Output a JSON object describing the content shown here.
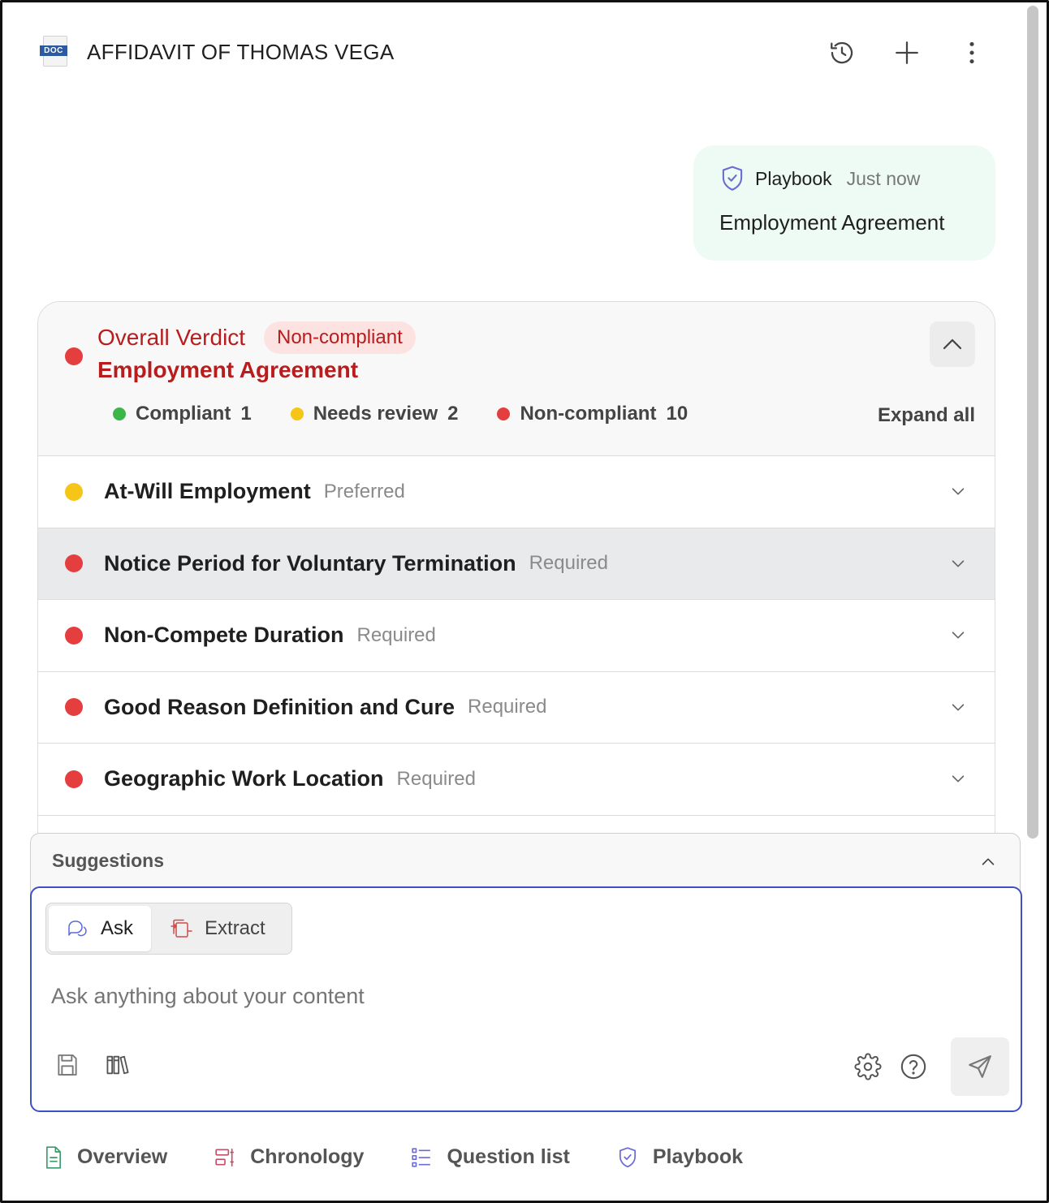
{
  "header": {
    "file_badge": "DOC",
    "title": "AFFIDAVIT OF THOMAS VEGA",
    "actions": [
      "history-icon",
      "plus-icon",
      "more-vertical-icon"
    ]
  },
  "message": {
    "source": "Playbook",
    "time": "Just now",
    "body": "Employment Agreement"
  },
  "verdict": {
    "label": "Overall Verdict",
    "status": "Non-compliant",
    "name": "Employment Agreement",
    "status_color": "#e53e3e",
    "stats": [
      {
        "label": "Compliant",
        "count": "1",
        "color": "#3cb54a"
      },
      {
        "label": "Needs review",
        "count": "2",
        "color": "#f5c518"
      },
      {
        "label": "Non-compliant",
        "count": "10",
        "color": "#e53e3e"
      }
    ],
    "expand_all": "Expand all"
  },
  "rules": [
    {
      "name": "At-Will Employment",
      "tag": "Preferred",
      "status": "yellow"
    },
    {
      "name": "Notice Period for Voluntary Termination",
      "tag": "Required",
      "status": "red"
    },
    {
      "name": "Non-Compete Duration",
      "tag": "Required",
      "status": "red"
    },
    {
      "name": "Good Reason Definition and Cure",
      "tag": "Required",
      "status": "red"
    },
    {
      "name": "Geographic Work Location",
      "tag": "Required",
      "status": "red"
    }
  ],
  "composer": {
    "suggestions_label": "Suggestions",
    "modes": [
      {
        "label": "Ask",
        "icon": "chat-bubbles-icon",
        "selected": true
      },
      {
        "label": "Extract",
        "icon": "extract-icon",
        "selected": false
      }
    ],
    "placeholder": "Ask anything about your content",
    "accent": "#3f4fc4"
  },
  "tabs": [
    {
      "label": "Overview",
      "icon": "document-icon"
    },
    {
      "label": "Chronology",
      "icon": "timeline-icon"
    },
    {
      "label": "Question list",
      "icon": "list-icon"
    },
    {
      "label": "Playbook",
      "icon": "shield-check-icon"
    }
  ]
}
